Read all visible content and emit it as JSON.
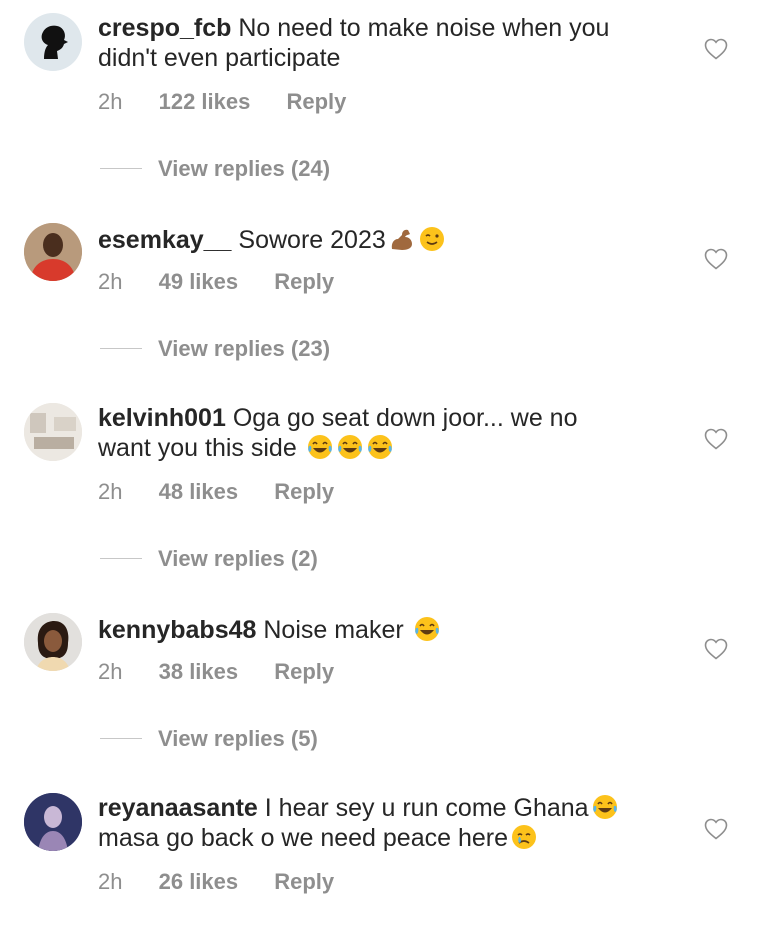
{
  "comments": [
    {
      "username": "crespo_fcb",
      "text_line1": "No need to make noise when you",
      "text_line2": "didn't even participate",
      "time": "2h",
      "likes": "122 likes",
      "reply": "Reply",
      "view_replies": "View replies (24)",
      "avatar_icon": "silhouette-avatar",
      "emojis": []
    },
    {
      "username": "esemkay__",
      "text_line1": "Sowore 2023",
      "text_line2": "",
      "time": "2h",
      "likes": "49 likes",
      "reply": "Reply",
      "view_replies": "View replies (23)",
      "avatar_icon": "photo-avatar",
      "emojis": [
        "flexed-biceps-emoji",
        "winking-face-emoji"
      ]
    },
    {
      "username": "kelvinh001",
      "text_line1": "Oga go seat down joor... we no",
      "text_line2": "want you this side",
      "time": "2h",
      "likes": "48 likes",
      "reply": "Reply",
      "view_replies": "View replies (2)",
      "avatar_icon": "photo-avatar",
      "emojis": [
        "tears-of-joy-emoji",
        "tears-of-joy-emoji",
        "tears-of-joy-emoji"
      ]
    },
    {
      "username": "kennybabs48",
      "text_line1": "Noise maker",
      "text_line2": "",
      "time": "2h",
      "likes": "38 likes",
      "reply": "Reply",
      "view_replies": "View replies (5)",
      "avatar_icon": "photo-avatar",
      "emojis": [
        "tears-of-joy-emoji"
      ]
    },
    {
      "username": "reyanaasante",
      "text_line1": "I hear sey u run come Ghana",
      "text_line2": "masa go back o we need peace here",
      "time": "2h",
      "likes": "26 likes",
      "reply": "Reply",
      "view_replies": "",
      "avatar_icon": "photo-avatar",
      "emojis": [
        "tears-of-joy-emoji",
        "crying-face-emoji"
      ]
    }
  ],
  "colors": {
    "text": "#262626",
    "secondary": "#8e8e8e",
    "divider": "#c7c7c7"
  },
  "icons": {
    "like": "heart-outline-icon"
  }
}
